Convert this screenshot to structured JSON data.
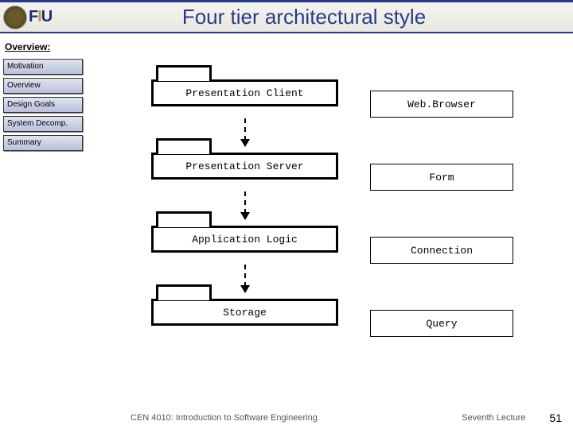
{
  "header": {
    "logo_letters": "FIU",
    "title": "Four tier architectural style"
  },
  "section_label": "Overview:",
  "sidebar": {
    "items": [
      {
        "label": "Motivation"
      },
      {
        "label": "Overview"
      },
      {
        "label": "Design Goals"
      },
      {
        "label": "System Decomp."
      },
      {
        "label": "Summary"
      }
    ]
  },
  "tiers": [
    {
      "pkg": "Presentation Client",
      "side": "Web.Browser"
    },
    {
      "pkg": "Presentation Server",
      "side": "Form"
    },
    {
      "pkg": "Application Logic",
      "side": "Connection"
    },
    {
      "pkg": "Storage",
      "side": "Query"
    }
  ],
  "footer": {
    "course": "CEN 4010: Introduction to Software Engineering",
    "lecture": "Seventh Lecture",
    "page": "51"
  }
}
